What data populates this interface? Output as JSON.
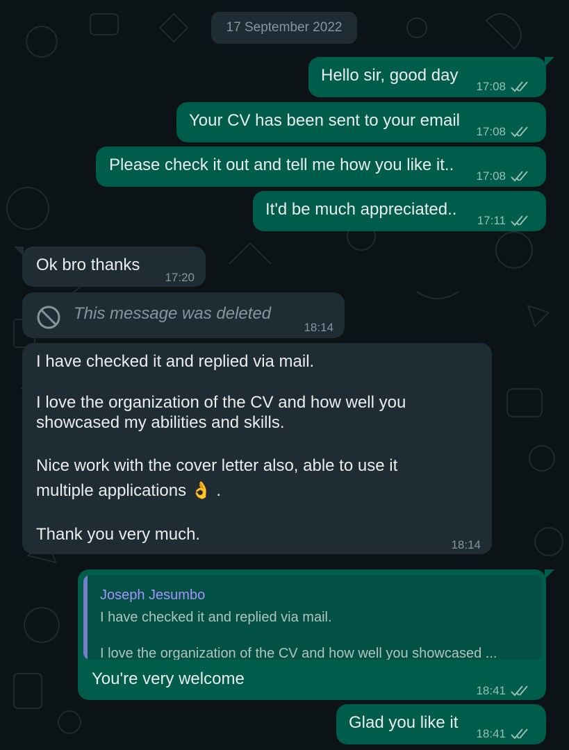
{
  "chat": {
    "date_label": "17 September 2022",
    "messages": [
      {
        "text": "Hello sir, good day",
        "time": "17:08"
      },
      {
        "text": "Your CV has been sent to your email",
        "time": "17:08"
      },
      {
        "text": "Please check it out and tell me how you like it..",
        "time": "17:08"
      },
      {
        "text": "It'd be much appreciated..",
        "time": "17:11"
      },
      {
        "text": "Ok bro thanks",
        "time": "17:20"
      },
      {
        "text": "This message was deleted",
        "time": "18:14"
      },
      {
        "p1": "I have checked it and replied via mail.",
        "p2": "I love the organization of the CV and how well you showcased my abilities and skills.",
        "p3": "Nice work with the cover letter also, able to use it multiple applications 👌 .",
        "p4": "Thank you very much.",
        "time": "18:14"
      },
      {
        "quote_author": "Joseph Jesumbo",
        "quote_line1": "I have checked it and replied via mail.",
        "quote_line2": "I love the organization of the CV and how well you showcased ...",
        "text": "You're very welcome",
        "time": "18:41"
      },
      {
        "text": "Glad you like it",
        "time": "18:41"
      }
    ]
  },
  "icons": {
    "read_receipt": "double-check-icon",
    "deleted": "prohibited-icon"
  },
  "colors": {
    "outgoing_bubble": "#005c4b",
    "incoming_bubble": "#202c33",
    "background": "#0c1317",
    "read_ticks": "#99beb7",
    "quote_accent": "#a791ff"
  }
}
